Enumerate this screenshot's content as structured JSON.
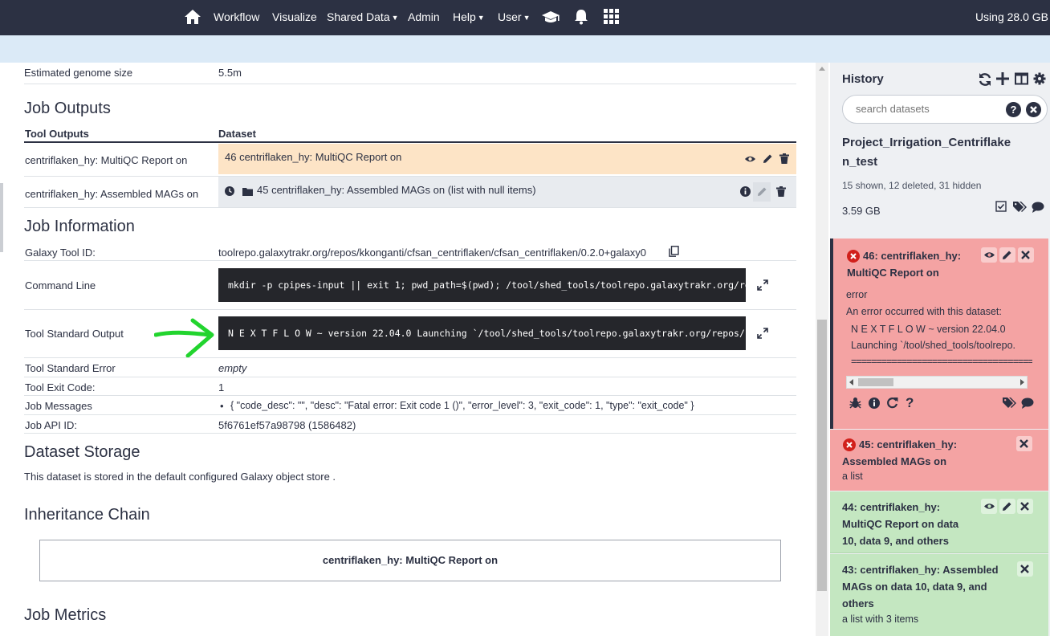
{
  "nav": {
    "items": [
      {
        "label": "Workflow"
      },
      {
        "label": "Visualize"
      },
      {
        "label": "Shared Data"
      },
      {
        "label": "Admin"
      },
      {
        "label": "Help"
      },
      {
        "label": "User"
      }
    ],
    "usage": "Using 28.0 GB"
  },
  "center": {
    "genome_label": "Estimated genome size",
    "genome_value": "5.5m",
    "job_outputs": {
      "heading": "Job Outputs",
      "col_outputs": "Tool Outputs",
      "col_dataset": "Dataset",
      "rows": [
        {
          "output": "centriflaken_hy: MultiQC Report on",
          "dataset": "46 centriflaken_hy: MultiQC Report on",
          "bg": "#fde4c6"
        },
        {
          "output": "centriflaken_hy: Assembled MAGs on",
          "dataset": "45 centriflaken_hy: Assembled MAGs on (list with null items)",
          "bg": "#e8ebef"
        }
      ]
    },
    "job_info": {
      "heading": "Job Information",
      "tool_id_label": "Galaxy Tool ID:",
      "tool_id": "toolrepo.galaxytrakr.org/repos/kkonganti/cfsan_centriflaken/cfsan_centriflaken/0.2.0+galaxy0",
      "command_label": "Command Line",
      "command": "mkdir -p cpipes-input || exit 1; pwd_path=$(pwd); /tool/shed_tools/toolrepo.galaxytrakr.org/rep…",
      "stdout_label": "Tool Standard Output",
      "stdout": "N E X T F L O W ~ version 22.04.0 Launching `/tool/shed_tools/toolrepo.galaxytrakr.org/repos/kk…",
      "stderr_label": "Tool Standard Error",
      "stderr": "empty",
      "exit_label": "Tool Exit Code:",
      "exit_code": "1",
      "messages_label": "Job Messages",
      "messages": "{ \"code_desc\": \"\", \"desc\": \"Fatal error: Exit code 1 ()\", \"error_level\": 3, \"exit_code\": 1, \"type\": \"exit_code\" }",
      "api_label": "Job API ID:",
      "api_id": "5f6761ef57a98798 (1586482)"
    },
    "storage": {
      "heading": "Dataset Storage",
      "text": "This dataset is stored in the default configured Galaxy object store ."
    },
    "inheritance": {
      "heading": "Inheritance Chain",
      "item": "centriflaken_hy: MultiQC Report on"
    },
    "metrics_heading": "Job Metrics"
  },
  "history": {
    "title": "History",
    "search_placeholder": "search datasets",
    "name": "Project_Irrigation_Centriflaken_test",
    "counts": "15 shown, 12 deleted, 31 hidden",
    "size": "3.59 GB",
    "datasets": [
      {
        "title": "46: centriflaken_hy: MultiQC Report on",
        "state": "error",
        "message": "An error occurred with this dataset:",
        "peek_line1": "N E X T F L O W  ~  version 22.04.0",
        "peek_line2": "Launching `/tool/shed_tools/toolrepo.",
        "peek_line3": "========================================"
      },
      {
        "title": "45: centriflaken_hy: Assembled MAGs on",
        "subtitle": "a list"
      },
      {
        "title": "44: centriflaken_hy: MultiQC Report on data 10, data 9, and others"
      },
      {
        "title": "43: centriflaken_hy: Assembled MAGs on data 10, data 9, and others",
        "subtitle": "a list with 3 items"
      }
    ]
  },
  "colors": {
    "nav_bg": "#2c3143",
    "subbar_bg": "#dbeaf7",
    "error_bg": "#f4a3a3",
    "ok_bg": "#c4e7c1",
    "annotation_arrow": "#22d42e"
  }
}
